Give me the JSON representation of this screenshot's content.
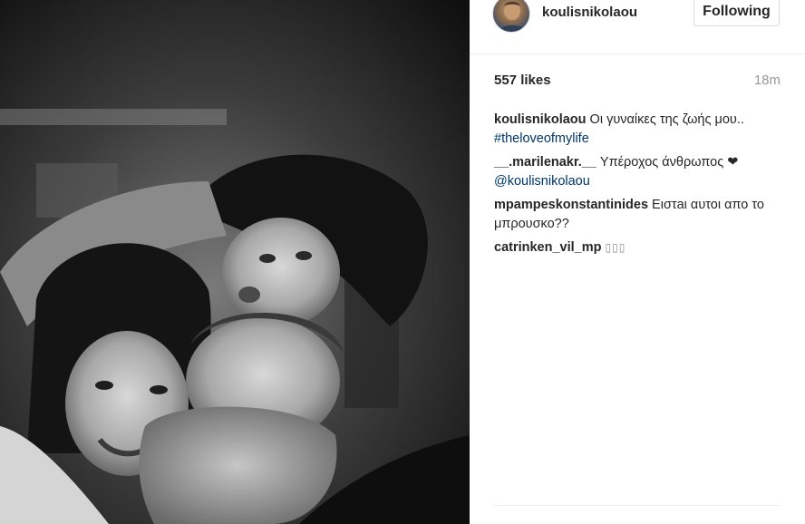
{
  "post": {
    "username": "koulisnikolaou",
    "follow_label": "Following",
    "likes": "557 likes",
    "time": "18m",
    "caption": {
      "user": "koulisnikolaou",
      "text": "Οι γυναίκες της ζωής μου..",
      "hashtag": "#theloveofmylife"
    },
    "comments": [
      {
        "user": "__.marilenakr.__",
        "text": "Υπέροχος άνθρωπος",
        "heart": "❤",
        "mention": "@koulisnikolaou"
      },
      {
        "user": "mpampeskonstantinides",
        "text": "Ειστaι αυτοι απο το μπρουσκο??"
      },
      {
        "user": "catrinken_vil_mp",
        "text": "▯▯▯"
      }
    ]
  },
  "photo": {
    "style": "black-and-white selfie of three people"
  },
  "colors": {
    "link": "#003569",
    "muted": "#999999",
    "text": "#262626",
    "border": "#dbdbdb"
  }
}
